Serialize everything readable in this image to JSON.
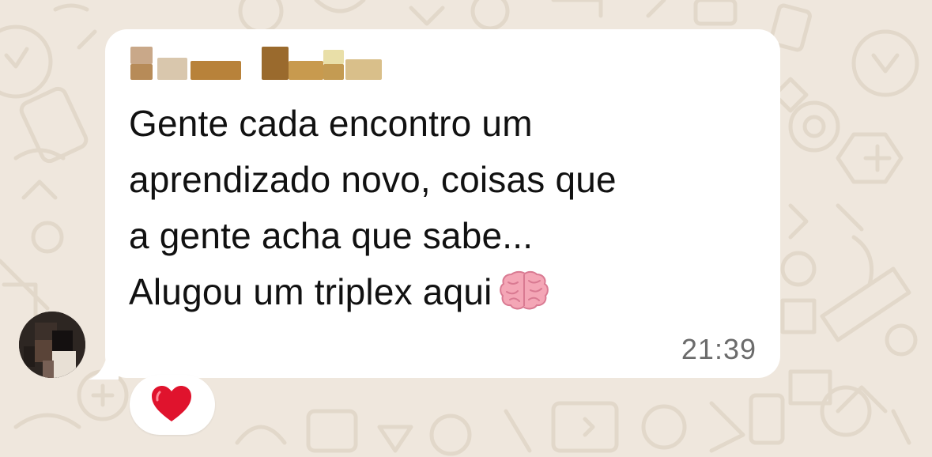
{
  "chat": {
    "background_color": "#efe7dd",
    "doodle_color": "#e3d9cc"
  },
  "message": {
    "sender_name": "B   M",
    "lines": [
      "Gente cada encontro um",
      "aprendizado novo, coisas que",
      "a gente acha que sabe...",
      "Alugou um triplex aqui"
    ],
    "emoji": "brain-icon",
    "timestamp": "21:39",
    "bubble_color": "#ffffff",
    "text_color": "#111111",
    "time_color": "#6b6b6b"
  },
  "reaction": {
    "emoji": "heart-icon",
    "color": "#e0132d"
  },
  "avatar": {
    "icon": "avatar",
    "pixelated": true
  }
}
